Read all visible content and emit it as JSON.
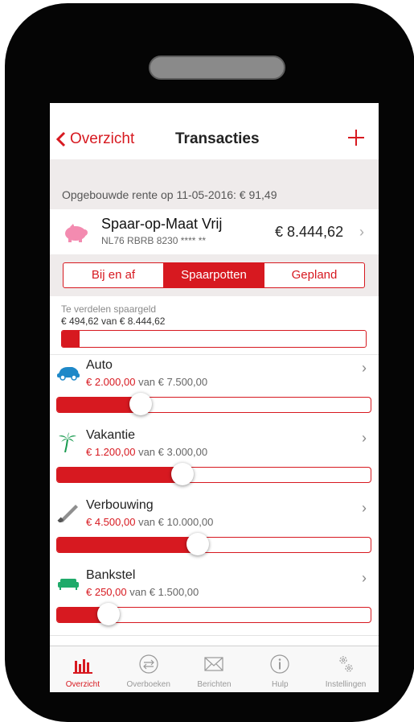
{
  "nav": {
    "back_label": "Overzicht",
    "title": "Transacties"
  },
  "interest_text": "Opgebouwde rente op 11-05-2016: € 91,49",
  "account": {
    "name": "Spaar-op-Maat Vrij",
    "iban": "NL76 RBRB 8230 **** **",
    "balance": "€ 8.444,62"
  },
  "segments": [
    {
      "label": "Bij en af",
      "active": false
    },
    {
      "label": "Spaarpotten",
      "active": true
    },
    {
      "label": "Gepland",
      "active": false
    }
  ],
  "to_distribute": {
    "label": "Te verdelen spaargeld",
    "value": "€ 494,62 van € 8.444,62",
    "fraction": 0.0586
  },
  "pots": [
    {
      "name": "Auto",
      "saved": "€ 2.000,00",
      "target_text": "van € 7.500,00",
      "fraction": 0.267,
      "icon": "car-icon"
    },
    {
      "name": "Vakantie",
      "saved": "€ 1.200,00",
      "target_text": "van € 3.000,00",
      "fraction": 0.4,
      "icon": "palm-tree-icon"
    },
    {
      "name": "Verbouwing",
      "saved": "€ 4.500,00",
      "target_text": "van € 10.000,00",
      "fraction": 0.45,
      "icon": "saw-icon"
    },
    {
      "name": "Bankstel",
      "saved": "€ 250,00",
      "target_text": "van € 1.500,00",
      "fraction": 0.167,
      "icon": "sofa-icon"
    }
  ],
  "tabs": [
    {
      "label": "Overzicht",
      "icon": "bar-chart-icon",
      "active": true
    },
    {
      "label": "Overboeken",
      "icon": "transfer-icon",
      "active": false
    },
    {
      "label": "Berichten",
      "icon": "envelope-icon",
      "active": false
    },
    {
      "label": "Hulp",
      "icon": "info-icon",
      "active": false
    },
    {
      "label": "Instellingen",
      "icon": "gears-icon",
      "active": false
    }
  ],
  "colors": {
    "accent": "#d71920",
    "pig": "#f38bb0",
    "car": "#1e88c8",
    "palm": "#1a9b50",
    "sofa": "#1faa6a"
  }
}
